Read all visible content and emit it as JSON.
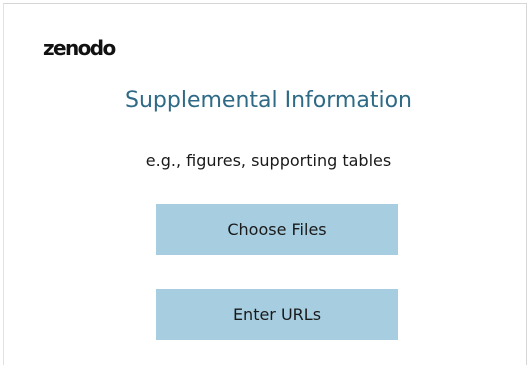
{
  "logo": {
    "text": "zenodo"
  },
  "main": {
    "title": "Supplemental Information",
    "subtitle": "e.g., figures, supporting tables"
  },
  "actions": {
    "choose_files_label": "Choose Files",
    "enter_urls_label": "Enter URLs"
  },
  "colors": {
    "title": "#2e6a86",
    "button_background": "#a6cde0",
    "text": "#1a1a1a"
  }
}
